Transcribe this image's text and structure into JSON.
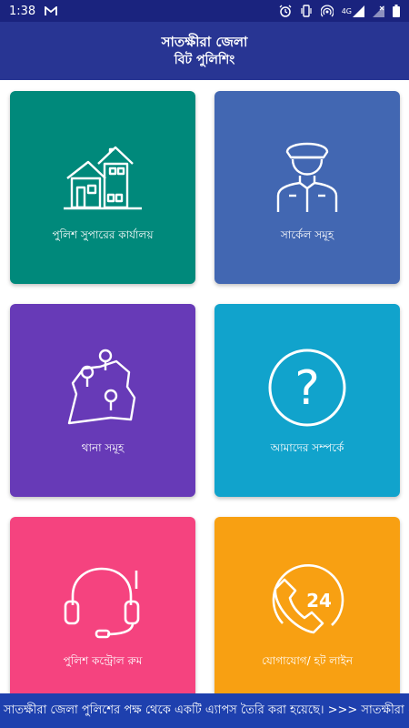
{
  "status_bar": {
    "time": "1:38",
    "network": "4G",
    "icons": [
      "gmail-icon",
      "alarm-icon",
      "vibrate-icon",
      "hotspot-icon",
      "signal-icon",
      "battery-icon"
    ]
  },
  "header": {
    "title": "সাতক্ষীরা জেলা",
    "subtitle": "বিট পুলিশিং"
  },
  "menu": {
    "items": [
      {
        "label": "পুলিশ সুপারের কার্যালয়",
        "icon": "office-building-icon",
        "color": "#00897b"
      },
      {
        "label": "সার্কেল সমূহ",
        "icon": "police-officer-icon",
        "color": "#4267b2"
      },
      {
        "label": "থানা সমূহ",
        "icon": "map-pins-icon",
        "color": "#673ab7"
      },
      {
        "label": "আমাদের সম্পর্কে",
        "icon": "question-icon",
        "color": "#11a3cc"
      },
      {
        "label": "পুলিশ কন্ট্রোল রুম",
        "icon": "headset-icon",
        "color": "#f5437f"
      },
      {
        "label": "যোগাযোগ/ হট লাইন",
        "icon": "hotline-24-icon",
        "color": "#f8a012",
        "badge": "24"
      }
    ]
  },
  "ticker": {
    "text": "সাতক্ষীরা জেলা পুলিশের পক্ষ থেকে একটি এ্যাপস তৈরি করা হয়েছে।   >>> সাতক্ষীরা জে"
  }
}
